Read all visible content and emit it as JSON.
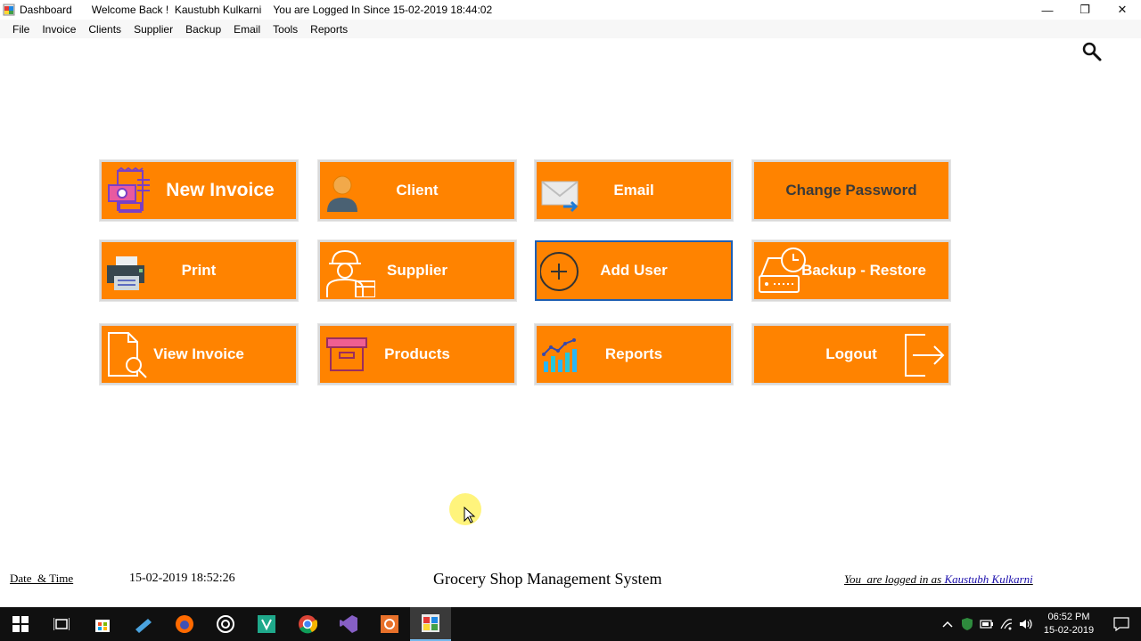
{
  "window": {
    "title": "Dashboard",
    "welcome": "Welcome Back !  Kaustubh Kulkarni    You are Logged In Since 15-02-2019 18:44:02",
    "minimize": "—",
    "restore": "❐",
    "close": "✕"
  },
  "menu": [
    "File",
    "Invoice",
    "Clients",
    "Supplier",
    "Backup",
    "Email",
    "Tools",
    "Reports"
  ],
  "tiles": {
    "new_invoice": "New Invoice",
    "client": "Client",
    "email": "Email",
    "change_password": "Change Password",
    "print": "Print",
    "supplier": "Supplier",
    "add_user": "Add User",
    "backup_restore": "Backup - Restore",
    "view_invoice": "View Invoice",
    "products": "Products",
    "reports": "Reports",
    "logout": "Logout"
  },
  "footer": {
    "date_time_label": "Date  & Time",
    "date_time_value": "15-02-2019 18:52:26",
    "app_name": "Grocery Shop Management System",
    "logged_in_prefix": "You  are logged in as",
    "logged_in_user": "Kaustubh Kulkarni"
  },
  "taskbar": {
    "time": "06:52 PM",
    "date": "15-02-2019"
  },
  "colors": {
    "tile": "#ff8300",
    "selected_border": "#1e5fb4",
    "taskbar": "#101010"
  }
}
